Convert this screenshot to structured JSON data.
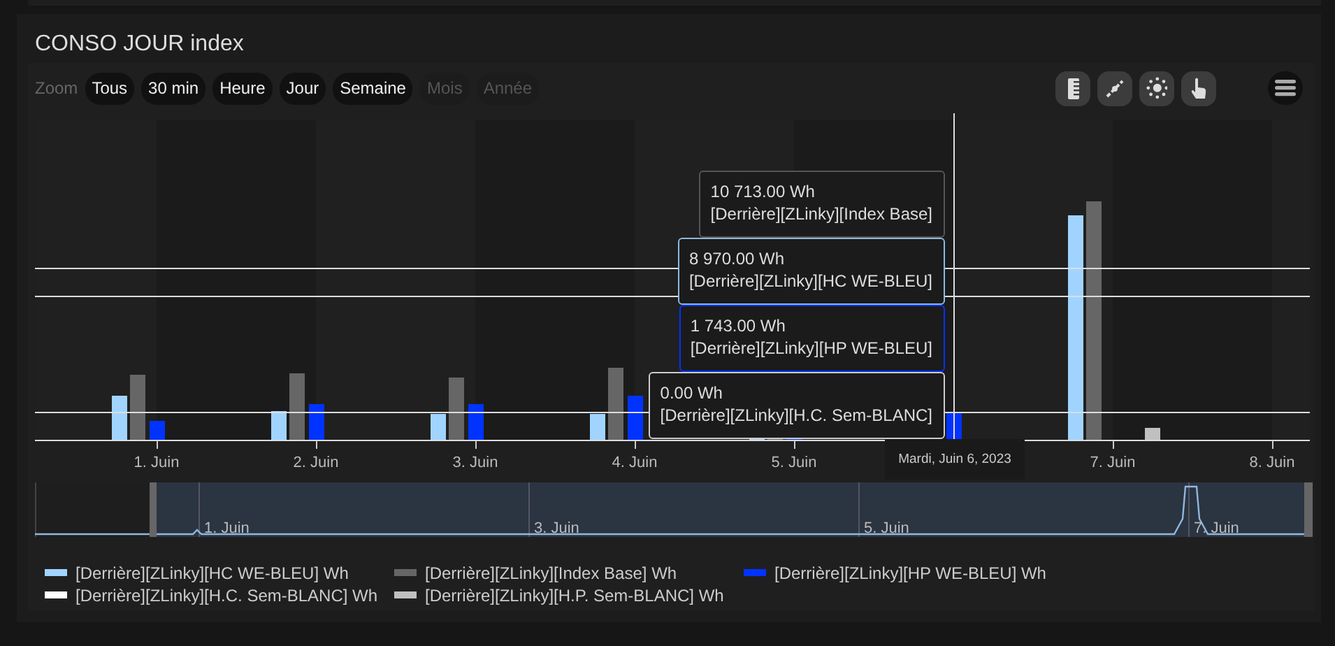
{
  "card": {
    "title": "CONSO JOUR index"
  },
  "zoom": {
    "label": "Zoom",
    "buttons": [
      {
        "label": "Tous",
        "disabled": false
      },
      {
        "label": "30 min",
        "disabled": false
      },
      {
        "label": "Heure",
        "disabled": false
      },
      {
        "label": "Jour",
        "disabled": false
      },
      {
        "label": "Semaine",
        "disabled": false
      },
      {
        "label": "Mois",
        "disabled": true
      },
      {
        "label": "Année",
        "disabled": true
      }
    ]
  },
  "toolbar": [
    {
      "kind": "ruler"
    },
    {
      "kind": "line"
    },
    {
      "kind": "sun"
    },
    {
      "kind": "hand"
    },
    {
      "kind": "menu"
    }
  ],
  "chart": {
    "x_axis_labels": [
      "1. Juin",
      "2. Juin",
      "3. Juin",
      "4. Juin",
      "5. Juin",
      "7. Juin",
      "8. Juin"
    ],
    "hover_date": "Mardi, Juin 6, 2023",
    "tooltips": [
      {
        "value": "10 713.00 Wh",
        "series": "[Derrière][ZLinky][Index Base]",
        "color": "#555555"
      },
      {
        "value": "8 970.00 Wh",
        "series": "[Derrière][ZLinky][HC WE-BLEU]",
        "color": "#8fb8de"
      },
      {
        "value": "1 743.00 Wh",
        "series": "[Derrière][ZLinky][HP WE-BLEU]",
        "color": "#0033ff"
      },
      {
        "value": "0.00 Wh",
        "series": "[Derrière][ZLinky][H.C. Sem-BLANC]",
        "color": "#cccccc"
      }
    ]
  },
  "navigator": {
    "labels": [
      "1. Juin",
      "3. Juin",
      "5. Juin",
      "7. Juin"
    ]
  },
  "legend": [
    {
      "label": "[Derrière][ZLinky][HC WE-BLEU] Wh",
      "color": "#a0d4ff"
    },
    {
      "label": "[Derrière][ZLinky][Index Base] Wh",
      "color": "#666666"
    },
    {
      "label": "[Derrière][ZLinky][HP WE-BLEU] Wh",
      "color": "#0033ff"
    },
    {
      "label": "[Derrière][ZLinky][H.C. Sem-BLANC] Wh",
      "color": "#ffffff"
    },
    {
      "label": "[Derrière][ZLinky][H.P. Sem-BLANC] Wh",
      "color": "#c0c0c0"
    }
  ]
}
